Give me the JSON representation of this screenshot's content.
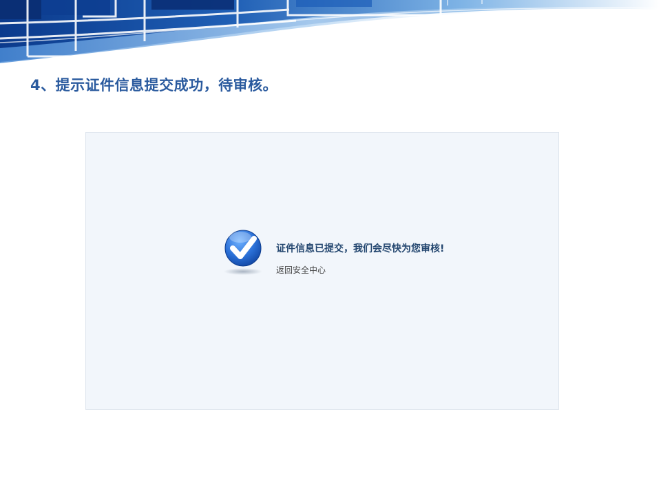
{
  "slide": {
    "title": "4、提示证件信息提交成功，待审核。"
  },
  "result_panel": {
    "icon": "check-circle-icon",
    "message": "证件信息已提交，我们会尽快为您审核!",
    "back_link_label": "返回安全中心"
  },
  "colors": {
    "title": "#2a5a9e",
    "banner_blue": "#1f5fb5",
    "panel_background": "#f2f6fb",
    "message_text": "#23466f"
  }
}
